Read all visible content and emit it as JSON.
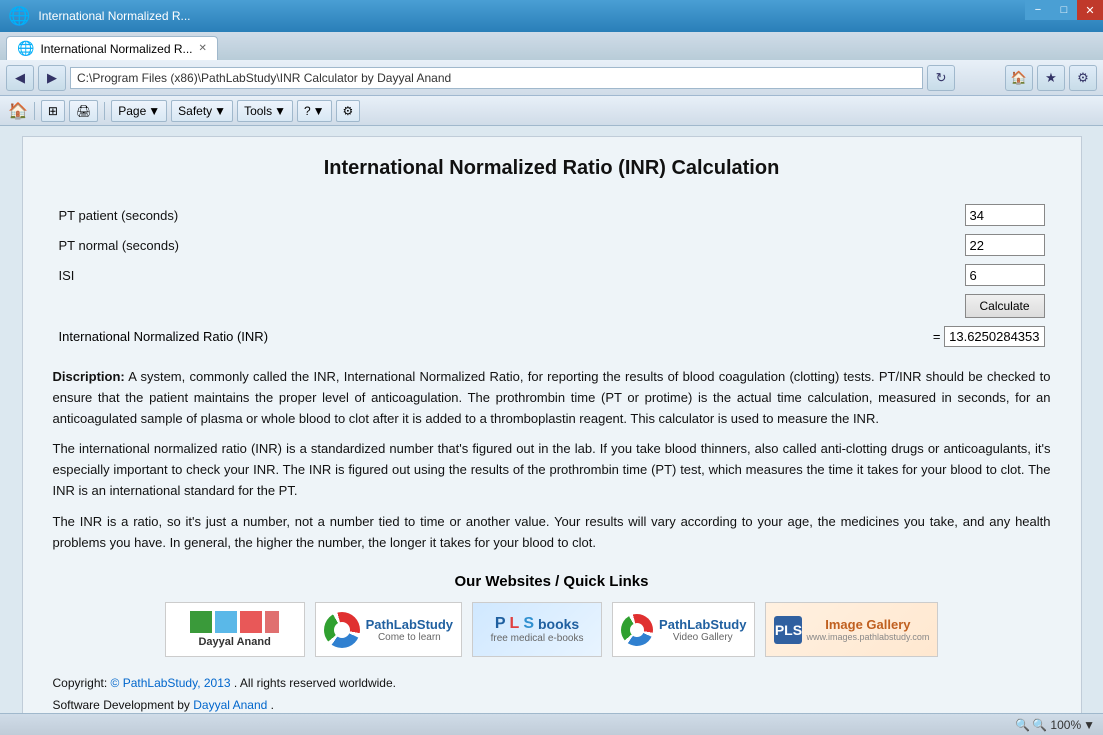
{
  "window": {
    "title": "International Normalized R...",
    "title_bar_label": "International Normalized R...",
    "min_btn": "−",
    "max_btn": "□",
    "close_btn": "✕"
  },
  "address_bar": {
    "back_label": "◀",
    "forward_label": "▶",
    "url": "C:\\Program Files (x86)\\PathLabStudy\\INR Calculator by Dayyal Anand",
    "refresh_label": "↻",
    "home_label": "🏠",
    "favorites_label": "★",
    "tools_label": "⚙"
  },
  "tab": {
    "label": "International Normalized R...",
    "close_label": "✕"
  },
  "toolbar": {
    "page_label": "Page",
    "safety_label": "Safety",
    "tools_label": "Tools",
    "help_label": "?",
    "settings_label": "⚙"
  },
  "page": {
    "title": "International Normalized Ratio (INR) Calculation",
    "fields": {
      "pt_patient_label": "PT patient (seconds)",
      "pt_patient_value": "34",
      "pt_normal_label": "PT normal (seconds)",
      "pt_normal_value": "22",
      "isi_label": "ISI",
      "isi_value": "6"
    },
    "calculate_button": "Calculate",
    "result_label": "International Normalized Ratio (INR)",
    "result_equals": "=",
    "result_value": "13.6250284353",
    "description_heading": "Discription:",
    "description_p1": "A system, commonly called the INR, International Normalized Ratio, for reporting the results of blood coagulation (clotting) tests. PT/INR should be checked to ensure that the patient maintains the proper level of anticoagulation. The prothrombin time (PT or protime) is the actual time calculation, measured in seconds, for an anticoagulated sample of plasma or whole blood to clot after it is added to a thromboplastin reagent. This calculator is used to measure the INR.",
    "description_p2": "The international normalized ratio (INR) is a standardized number that's figured out in the lab. If you take blood thinners, also called anti-clotting drugs or anticoagulants, it's especially important to check your INR. The INR is figured out using the results of the prothrombin time (PT) test, which measures the time it takes for your blood to clot. The INR is an international standard for the PT.",
    "description_p3": "The INR is a ratio, so it's just a number, not a number tied to time or another value. Your results will vary according to your age, the medicines you take, and any health problems you have. In general, the higher the number, the longer it takes for your blood to clot.",
    "quick_links_title": "Our Websites / Quick Links",
    "logos": [
      {
        "id": "dayyal-anand",
        "label": "Dayyal Anand"
      },
      {
        "id": "pathlab-study",
        "label": "PathLabStudy\nCome to learn"
      },
      {
        "id": "pls-books",
        "label": "PLS books\nfree medical e-books"
      },
      {
        "id": "pathlab-video",
        "label": "PathLabStudy\nVideo Gallery"
      },
      {
        "id": "image-gallery",
        "label": "Image Gallery\nwww.images.pathlabstudy.com"
      }
    ],
    "copyright_text": "Copyright: ",
    "copyright_link": "© PathLabStudy, 2013",
    "copyright_rest": ". All rights reserved worldwide.",
    "software_dev": "Software Development by ",
    "software_dev_link": "Dayyal Anand",
    "software_dev_end": "."
  },
  "status_bar": {
    "zoom_label": "🔍 100%",
    "dropdown": "▼"
  }
}
